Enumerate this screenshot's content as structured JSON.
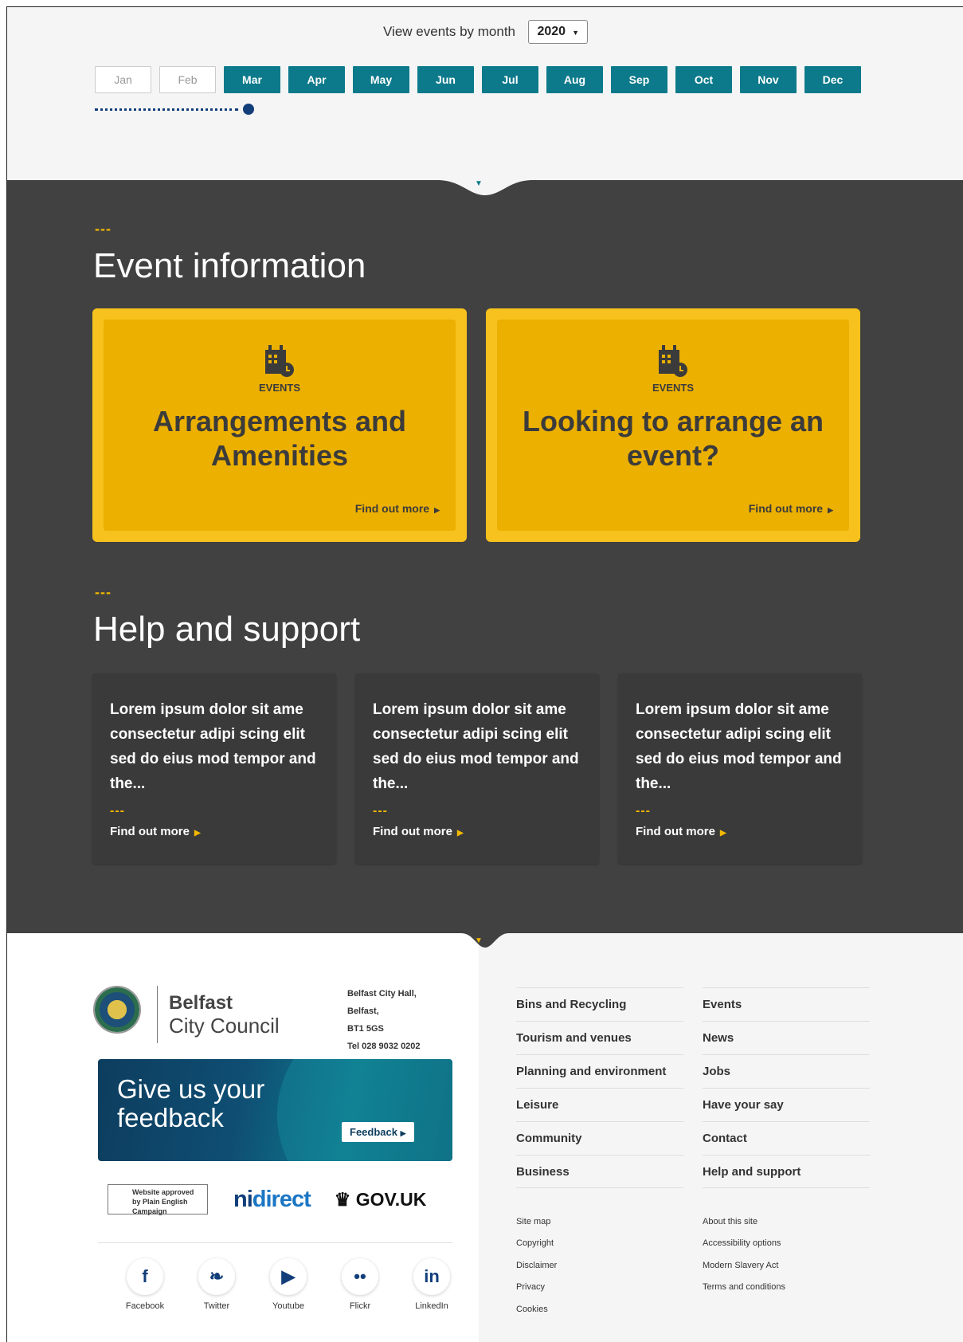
{
  "month_nav": {
    "label": "View events by month",
    "year": "2020",
    "months": [
      {
        "label": "Jan",
        "active": false
      },
      {
        "label": "Feb",
        "active": false
      },
      {
        "label": "Mar",
        "active": true
      },
      {
        "label": "Apr",
        "active": true
      },
      {
        "label": "May",
        "active": true
      },
      {
        "label": "Jun",
        "active": true
      },
      {
        "label": "Jul",
        "active": true
      },
      {
        "label": "Aug",
        "active": true
      },
      {
        "label": "Sep",
        "active": true
      },
      {
        "label": "Oct",
        "active": true
      },
      {
        "label": "Nov",
        "active": true
      },
      {
        "label": "Dec",
        "active": true
      }
    ]
  },
  "event_info": {
    "title": "Event information",
    "cards": [
      {
        "tag": "EVENTS",
        "title": "Arrangements and Amenities",
        "link": "Find out more",
        "icon": "calendar-building-icon"
      },
      {
        "tag": "EVENTS",
        "title": "Looking to arrange an event?",
        "link": "Find out more",
        "icon": "calendar-building-icon"
      }
    ]
  },
  "help": {
    "title": "Help and support",
    "cards": [
      {
        "text": "Lorem ipsum dolor sit ame consectetur adipi scing elit sed do eius mod tempor and the...",
        "link": "Find out more"
      },
      {
        "text": "Lorem ipsum dolor sit ame consectetur adipi scing elit sed do eius mod tempor and the...",
        "link": "Find out more"
      },
      {
        "text": "Lorem ipsum dolor sit ame consectetur adipi scing elit sed do eius mod tempor and the...",
        "link": "Find out more"
      }
    ]
  },
  "footer": {
    "logo_line1": "Belfast",
    "logo_line2": "City Council",
    "address": [
      "Belfast City Hall,",
      "Belfast,",
      "BT1 5GS",
      "Tel 028 9032 0202"
    ],
    "feedback_title": "Give us your feedback",
    "feedback_button": "Feedback",
    "badges": {
      "plain_english": "Website approved by Plain English Campaign",
      "nidirect_ni": "ni",
      "nidirect_direct": "direct",
      "govuk": "GOV.UK"
    },
    "socials": [
      {
        "label": "Facebook",
        "glyph": "f",
        "icon": "facebook-icon"
      },
      {
        "label": "Twitter",
        "glyph": "❧",
        "icon": "twitter-icon"
      },
      {
        "label": "Youtube",
        "glyph": "▶",
        "icon": "youtube-icon"
      },
      {
        "label": "Flickr",
        "glyph": "••",
        "icon": "flickr-icon"
      },
      {
        "label": "LinkedIn",
        "glyph": "in",
        "icon": "linkedin-icon"
      }
    ],
    "nav_col1": [
      "Bins and Recycling",
      "Tourism and venues",
      "Planning and environment",
      "Leisure",
      "Community",
      "Business"
    ],
    "nav_col2": [
      "Events",
      "News",
      "Jobs",
      "Have your say",
      "Contact",
      "Help and support"
    ],
    "small_col1": [
      "Site map",
      "Copyright",
      "Disclaimer",
      "Privacy",
      "Cookies"
    ],
    "small_col2": [
      "About this site",
      "Accessibility options",
      "Modern Slavery Act",
      "Terms and conditions"
    ]
  },
  "colors": {
    "teal": "#0d7a8b",
    "navy": "#123e7a",
    "yellow": "#f3b800",
    "dark": "#414141"
  }
}
